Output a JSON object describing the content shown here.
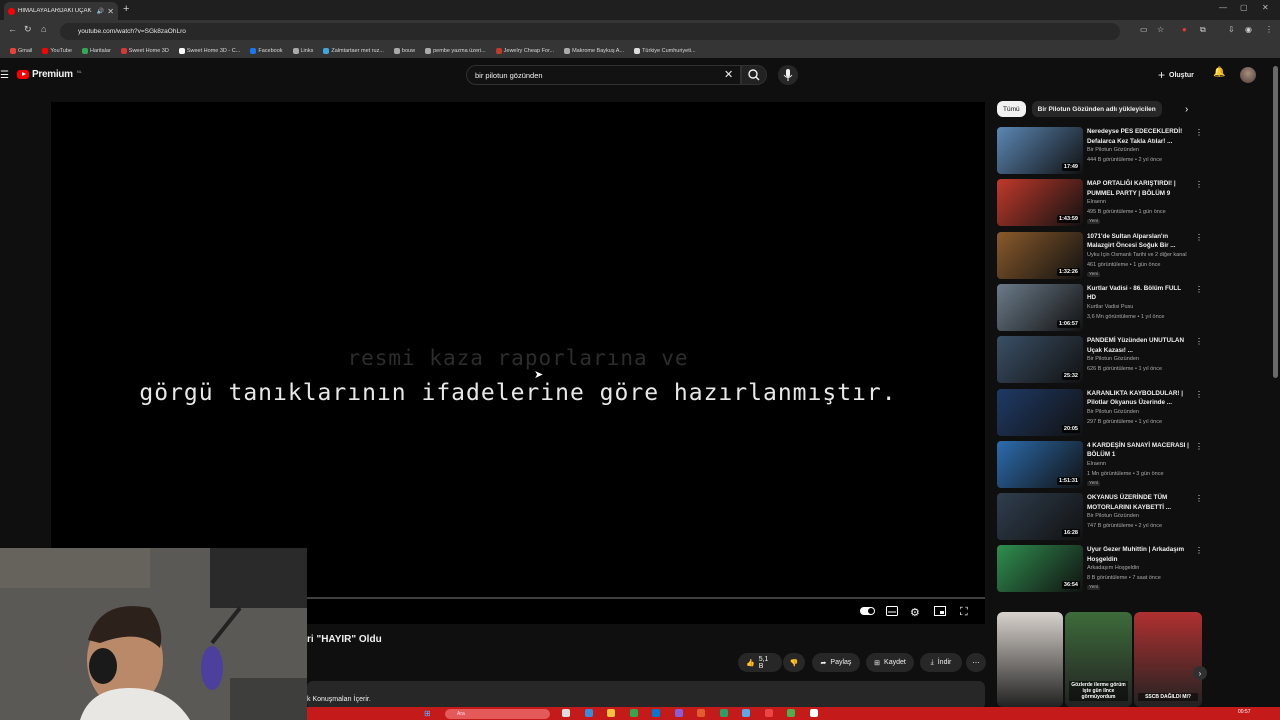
{
  "browser": {
    "tab_title": "HİMALAYALARDAKİ UÇAK",
    "url": "youtube.com/watch?v=SGk8zaOhLro",
    "bookmarks": [
      {
        "label": "Gmail",
        "color": "#ea4335"
      },
      {
        "label": "YouTube",
        "color": "#ff0000"
      },
      {
        "label": "Haritalar",
        "color": "#34a853"
      },
      {
        "label": "Sweet Home 3D",
        "color": "#d93636"
      },
      {
        "label": "Sweet Home 3D - C...",
        "color": "#ffffff"
      },
      {
        "label": "Facebook",
        "color": "#1877f2"
      },
      {
        "label": "Links",
        "color": "#aaaaaa"
      },
      {
        "label": "Zalmtartaer met ruz...",
        "color": "#3fa7e0"
      },
      {
        "label": "bouw",
        "color": "#aaaaaa"
      },
      {
        "label": "pembe yazma üzeri...",
        "color": "#aaaaaa"
      },
      {
        "label": "Jewelry Cheap For...",
        "color": "#c0392b"
      },
      {
        "label": "Makrome Baykuş A...",
        "color": "#aaaaaa"
      },
      {
        "label": "Türkiye Cumhuriyeti...",
        "color": "#dddddd"
      }
    ]
  },
  "header": {
    "logo_text": "Premium",
    "logo_region": "NL",
    "search_value": "bir pilotun gözünden",
    "create_label": "Oluştur"
  },
  "player": {
    "subtitle_faded": "resmi kaza raporlarına ve",
    "subtitle_main": "görgü tanıklarının ifadelerine göre hazırlanmıştır."
  },
  "video": {
    "title_visible": "ri \"HAYIR\" Oldu",
    "likes": "5,1 B",
    "share_label": "Paylaş",
    "save_label": "Kaydet",
    "download_label": "İndir",
    "desc_fragment": "k Konuşmaları İçerir."
  },
  "sidebar": {
    "chips": [
      "Tümü",
      "Bir Pilotun Gözünden adlı yükleyicilen"
    ],
    "recommendations": [
      {
        "title": "Neredeyse PES EDECEKLERDİ! Defalarca Kez Takla Atılar! ...",
        "channel": "Bir Pilotun Gözünden",
        "meta": "444 B görüntüleme • 2 yıl önce",
        "duration": "17:49",
        "badge": "",
        "thumb": "#5b87b5"
      },
      {
        "title": "MAP ORTALIĞI KARIŞTIRDI! | PUMMEL PARTY | BÖLÜM 9",
        "channel": "Elraenn",
        "meta": "495 B görüntüleme • 1 gün önce",
        "duration": "1:43:59",
        "badge": "Yeni",
        "thumb": "#c0392b"
      },
      {
        "title": "1071'de Sultan Alparslan'ın Malazgirt Öncesi Soğuk Bir ...",
        "channel": "Uyku İçin Osmanlı Tarihi ve 2 diğer kanal",
        "meta": "461 görüntüleme • 1 gün önce",
        "duration": "1:32:26",
        "badge": "Yeni",
        "thumb": "#8a5a2b"
      },
      {
        "title": "Kurtlar Vadisi - 86. Bölüm FULL HD",
        "channel": "Kurtlar Vadisi Pusu",
        "meta": "3,6 Mn görüntüleme • 1 yıl önce",
        "duration": "1:06:57",
        "badge": "",
        "thumb": "#6b7b8a"
      },
      {
        "title": "PANDEMİ Yüzünden UNUTULAN Uçak Kazası! ...",
        "channel": "Bir Pilotun Gözünden",
        "meta": "626 B görüntüleme • 1 yıl önce",
        "duration": "25:32",
        "badge": "",
        "thumb": "#3a4f66"
      },
      {
        "title": "KARANLIKTA KAYBOLDULAR! | Pilotlar Okyanus Üzerinde ...",
        "channel": "Bir Pilotun Gözünden",
        "meta": "297 B görüntüleme • 1 yıl önce",
        "duration": "20:05",
        "badge": "",
        "thumb": "#1f3a66"
      },
      {
        "title": "4 KARDEŞİN SANAYİ MACERASI | BÖLÜM 1",
        "channel": "Elraenn",
        "meta": "1 Mn görüntüleme • 3 gün önce",
        "duration": "1:51:31",
        "badge": "Yeni",
        "thumb": "#2c6cae"
      },
      {
        "title": "OKYANUS ÜZERİNDE TÜM MOTORLARINI KAYBETTİ ...",
        "channel": "Bir Pilotun Gözünden",
        "meta": "747 B görüntüleme • 2 yıl önce",
        "duration": "16:28",
        "badge": "",
        "thumb": "#2f3e4e"
      },
      {
        "title": "Uyur Gezer Muhittin | Arkadaşım Hoşgeldin",
        "channel": "Arkadaşım Hoşgeldin",
        "meta": "8 B görüntüleme • 7 saat önce",
        "duration": "36:54",
        "badge": "Yeni",
        "thumb": "#2f8f4f"
      }
    ],
    "shelf": [
      {
        "thumb": "#d8d2cc",
        "caption": ""
      },
      {
        "thumb": "#3d6b3a",
        "caption": "Gözlerde ilerme görüm işte gün ilnce görmüyordum"
      },
      {
        "thumb": "#b03030",
        "caption": "SSCB DAĞILDI MI?"
      }
    ]
  },
  "taskbar": {
    "search_placeholder": "Ara",
    "time": "00:57",
    "color": "#c41a1a"
  }
}
